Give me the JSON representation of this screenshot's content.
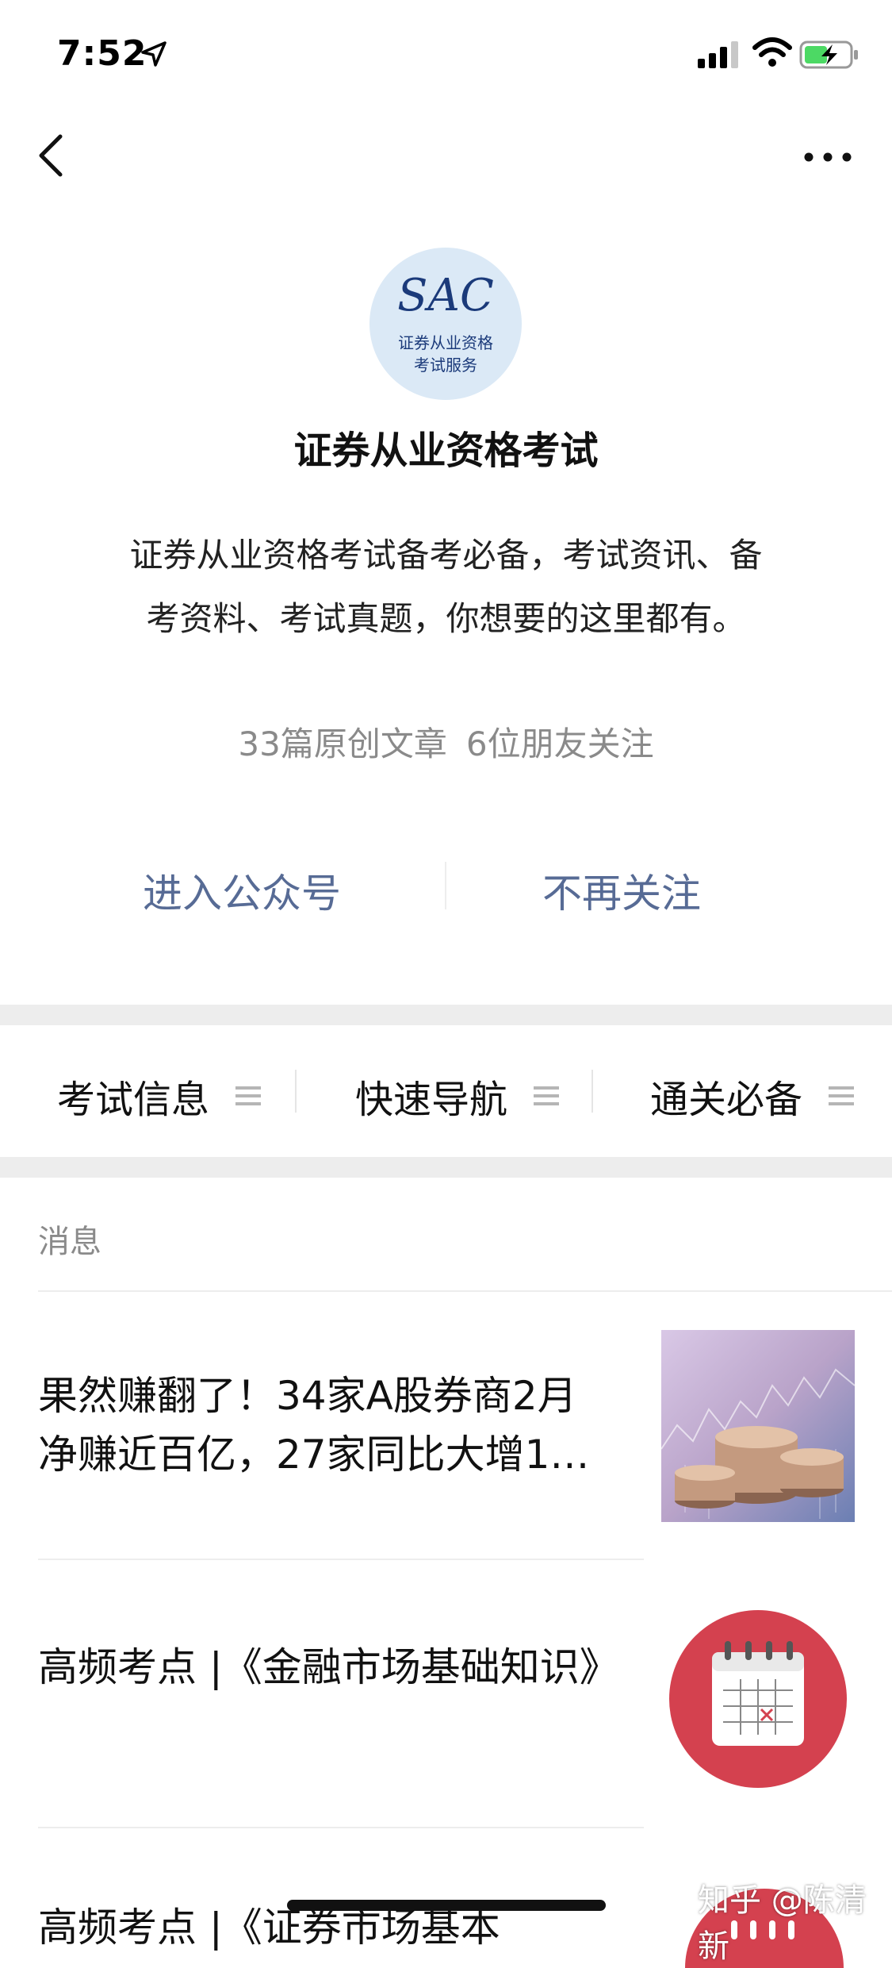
{
  "status_bar": {
    "time": "7:52",
    "icons": [
      "location-arrow-icon",
      "cellular-signal-icon",
      "wifi-icon",
      "battery-charging-icon"
    ]
  },
  "nav": {
    "back_icon": "chevron-left-icon",
    "more_icon": "ellipsis-icon"
  },
  "account": {
    "avatar": {
      "logo_text": "SAC",
      "line1": "证券从业资格",
      "line2": "考试服务",
      "bg_color": "#dbe9f6",
      "text_color": "#1b3a7a"
    },
    "name": "证券从业资格考试",
    "description": "证券从业资格考试备考必备，考试资讯、备考资料、考试真题，你想要的这里都有。",
    "stats": {
      "articles": "33篇原创文章",
      "friends": "6位朋友关注"
    }
  },
  "actions": {
    "enter_label": "进入公众号",
    "unfollow_label": "不再关注",
    "link_color": "#576b95"
  },
  "menu": {
    "items": [
      {
        "label": "考试信息",
        "icon": "menu-lines-icon"
      },
      {
        "label": "快速导航",
        "icon": "menu-lines-icon"
      },
      {
        "label": "通关必备",
        "icon": "menu-lines-icon"
      }
    ]
  },
  "messages": {
    "section_title": "消息",
    "items": [
      {
        "title": "果然赚翻了！34家A股券商2月净赚近百亿，27家同比大增1…",
        "thumbnail": "coins-chart-image"
      },
      {
        "title": "高频考点 |《金融市场基础知识》",
        "thumbnail": "calendar-icon"
      },
      {
        "title": "高频考点 |《证券市场基本",
        "thumbnail": "calendar-icon"
      }
    ]
  },
  "watermark": "知乎 @陈清新"
}
